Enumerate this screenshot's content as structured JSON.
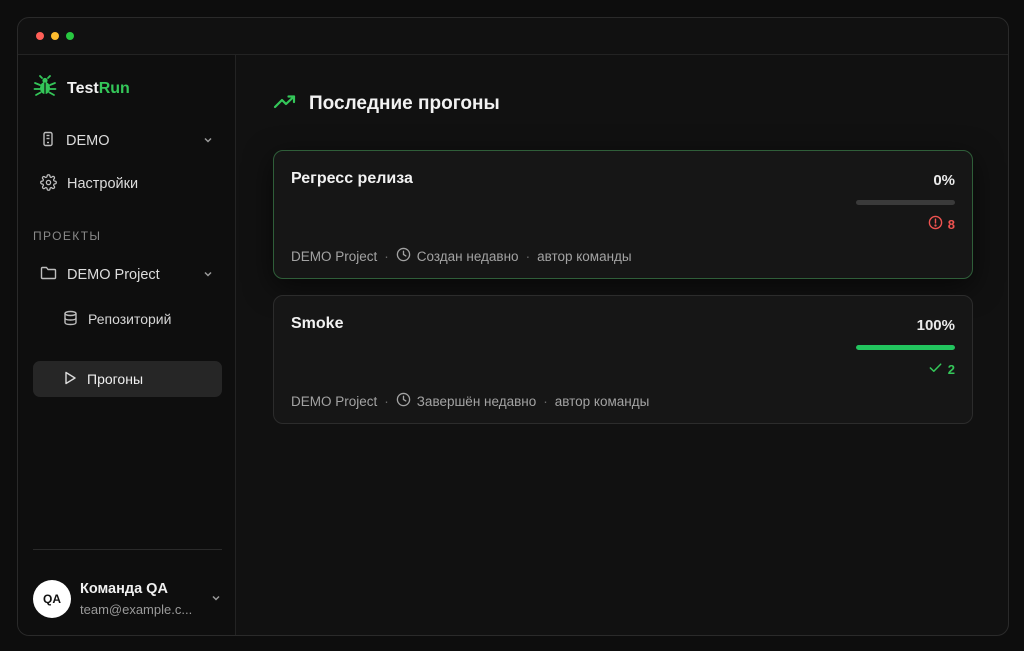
{
  "app": {
    "logo_prefix": "Test",
    "logo_suffix": "Run",
    "brand_color": "#34c759"
  },
  "sidebar": {
    "workspace": {
      "label": "DEMO",
      "icon": "phone-icon"
    },
    "settings": {
      "label": "Настройки",
      "icon": "gear-icon"
    },
    "section_label": "ПРОЕКТЫ",
    "project": {
      "label": "DEMO Project",
      "icon": "folder-icon"
    },
    "sub_items": [
      {
        "label": "Репозиторий",
        "icon": "database-icon",
        "active": false
      },
      {
        "label": "Прогоны",
        "icon": "play-icon",
        "active": true
      }
    ],
    "user": {
      "initials": "QA",
      "name": "Команда QA",
      "email": "team@example.c..."
    }
  },
  "main": {
    "title": "Последние прогоны",
    "title_icon": "trending-up-icon",
    "runs": [
      {
        "title": "Регресс релиза",
        "percent_label": "0%",
        "progress": 0,
        "status_type": "fail",
        "status_icon": "alert-circle-icon",
        "status_count": "8",
        "project": "DEMO Project",
        "time_label": "Создан недавно",
        "author": "автор команды"
      },
      {
        "title": "Smoke",
        "percent_label": "100%",
        "progress": 100,
        "status_type": "pass",
        "status_icon": "check-icon",
        "status_count": "2",
        "project": "DEMO Project",
        "time_label": "Завершён недавно",
        "author": "автор команды"
      }
    ]
  }
}
